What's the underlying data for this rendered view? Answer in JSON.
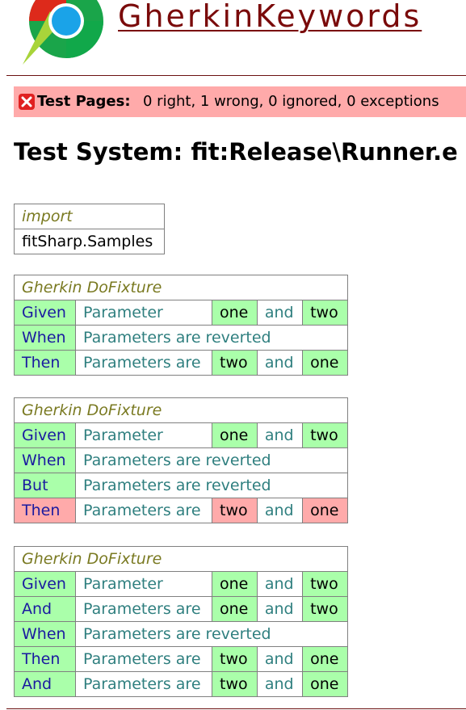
{
  "app": {
    "title": "GherkinKeywords"
  },
  "status": {
    "label": "Test Pages:",
    "counts": "0 right, 1 wrong, 0 ignored, 0 exceptions",
    "color": "#ffaaaa"
  },
  "heading": "Test System: fit:Release\\Runner.e",
  "import_table": {
    "title": "import",
    "value": "fitSharp.Samples"
  },
  "fixture_tables": [
    {
      "title": "Gherkin DoFixture",
      "rows": [
        {
          "keyword": "Given",
          "keyword_status": "pass",
          "text": "Parameter",
          "arg1": "one",
          "arg1_status": "pass",
          "and": "and",
          "arg2": "two",
          "arg2_status": "pass"
        },
        {
          "keyword": "When",
          "keyword_status": "pass",
          "text": "Parameters are reverted"
        },
        {
          "keyword": "Then",
          "keyword_status": "pass",
          "text": "Parameters are",
          "arg1": "two",
          "arg1_status": "pass",
          "and": "and",
          "arg2": "one",
          "arg2_status": "pass"
        }
      ]
    },
    {
      "title": "Gherkin DoFixture",
      "rows": [
        {
          "keyword": "Given",
          "keyword_status": "pass",
          "text": "Parameter",
          "arg1": "one",
          "arg1_status": "pass",
          "and": "and",
          "arg2": "two",
          "arg2_status": "pass"
        },
        {
          "keyword": "When",
          "keyword_status": "pass",
          "text": "Parameters are reverted"
        },
        {
          "keyword": "But",
          "keyword_status": "pass",
          "text": "Parameters are reverted"
        },
        {
          "keyword": "Then",
          "keyword_status": "fail",
          "text": "Parameters are",
          "arg1": "two",
          "arg1_status": "fail",
          "and": "and",
          "arg2": "one",
          "arg2_status": "fail"
        }
      ]
    },
    {
      "title": "Gherkin DoFixture",
      "rows": [
        {
          "keyword": "Given",
          "keyword_status": "pass",
          "text": "Parameter",
          "arg1": "one",
          "arg1_status": "pass",
          "and": "and",
          "arg2": "two",
          "arg2_status": "pass"
        },
        {
          "keyword": "And",
          "keyword_status": "pass",
          "text": "Parameters are",
          "arg1": "one",
          "arg1_status": "pass",
          "and": "and",
          "arg2": "two",
          "arg2_status": "pass"
        },
        {
          "keyword": "When",
          "keyword_status": "pass",
          "text": "Parameters are reverted"
        },
        {
          "keyword": "Then",
          "keyword_status": "pass",
          "text": "Parameters are",
          "arg1": "two",
          "arg1_status": "pass",
          "and": "and",
          "arg2": "one",
          "arg2_status": "pass"
        },
        {
          "keyword": "And",
          "keyword_status": "pass",
          "text": "Parameters are",
          "arg1": "two",
          "arg1_status": "pass",
          "and": "and",
          "arg2": "one",
          "arg2_status": "pass"
        }
      ]
    }
  ],
  "colors": {
    "pass": "#aaffaa",
    "fail": "#ffaaaa",
    "title_link": "#7a0a0a"
  },
  "icons": {
    "logo": "fitnesse-logo",
    "status": "error-x-icon"
  }
}
